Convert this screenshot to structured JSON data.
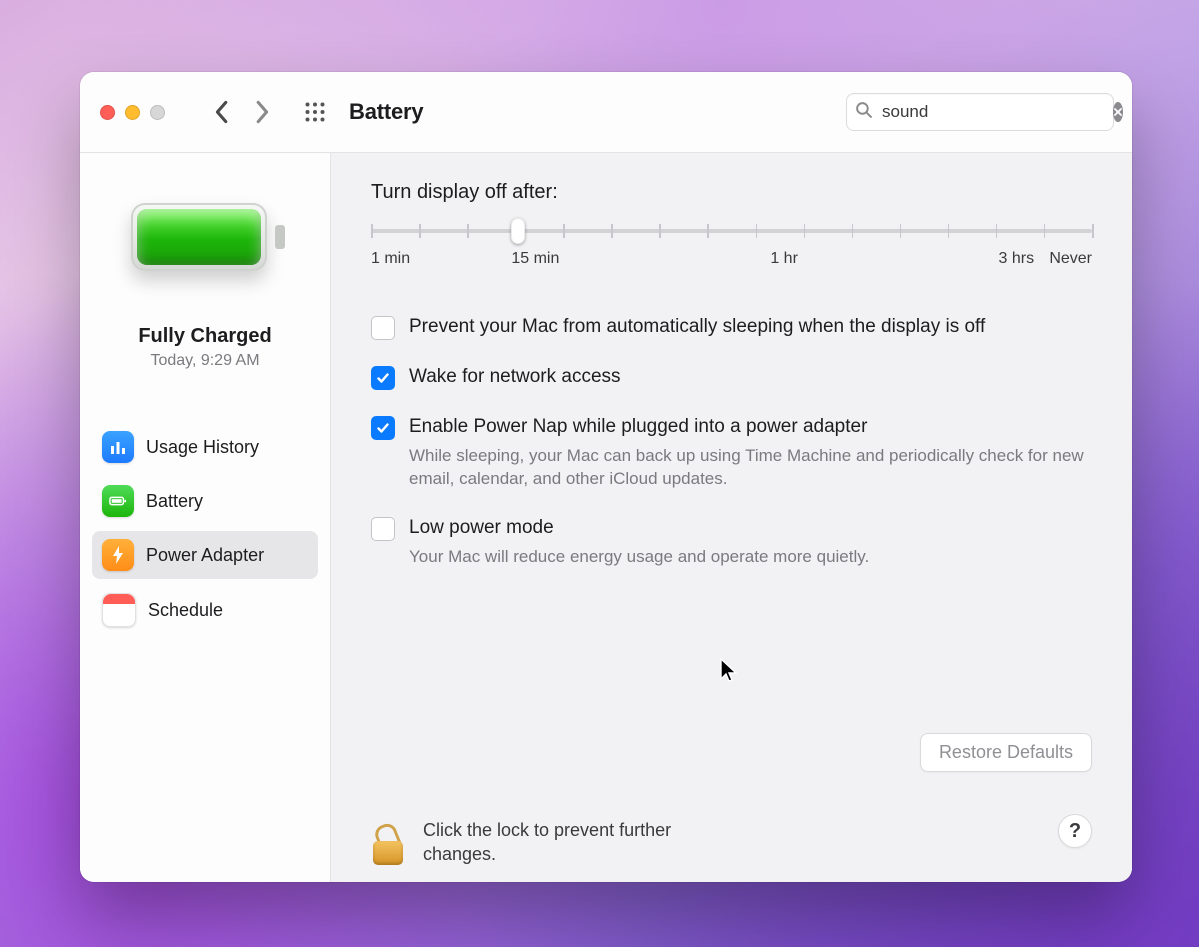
{
  "toolbar": {
    "title": "Battery",
    "search_value": "sound"
  },
  "sidebar": {
    "status_title": "Fully Charged",
    "status_time": "Today, 9:29 AM",
    "items": [
      {
        "label": "Usage History"
      },
      {
        "label": "Battery"
      },
      {
        "label": "Power Adapter"
      },
      {
        "label": "Schedule"
      }
    ]
  },
  "content": {
    "slider_label": "Turn display off after:",
    "slider_ticks": [
      "1 min",
      "15 min",
      "1 hr",
      "3 hrs",
      "Never"
    ],
    "slider_value_percent": 20.4,
    "options": {
      "prevent_sleep": {
        "label": "Prevent your Mac from automatically sleeping when the display is off",
        "checked": false
      },
      "wake_network": {
        "label": "Wake for network access",
        "checked": true
      },
      "power_nap": {
        "label": "Enable Power Nap while plugged into a power adapter",
        "desc": "While sleeping, your Mac can back up using Time Machine and periodically check for new email, calendar, and other iCloud updates.",
        "checked": true
      },
      "low_power": {
        "label": "Low power mode",
        "desc": "Your Mac will reduce energy usage and operate more quietly.",
        "checked": false
      }
    },
    "restore_label": "Restore Defaults",
    "lock_text": "Click the lock to prevent further changes.",
    "help_label": "?"
  }
}
